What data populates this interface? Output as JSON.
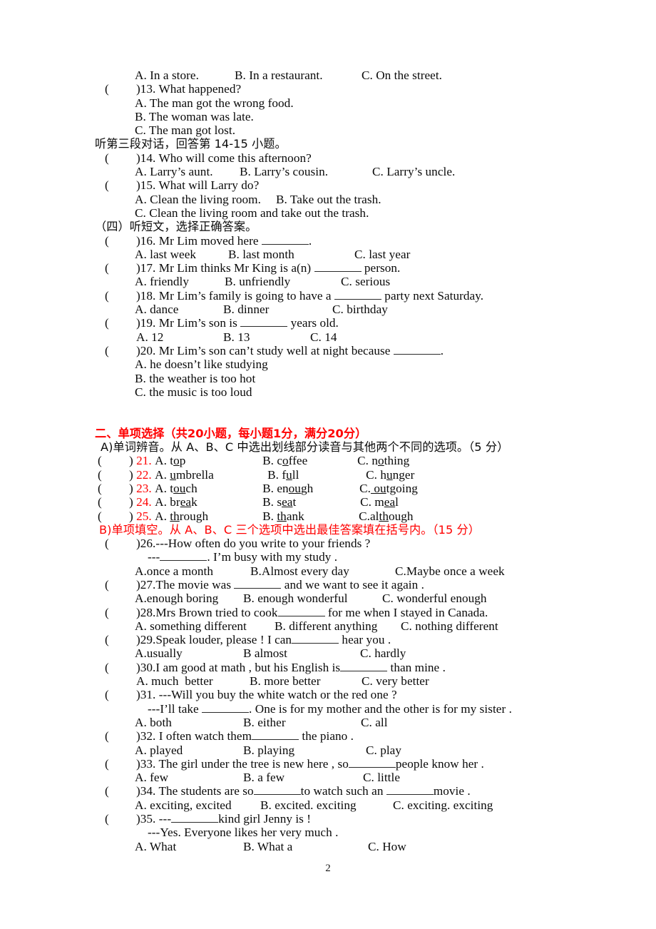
{
  "document": {
    "page_number": "2",
    "accent_color": "#ff0000",
    "text_color": "#0a0a0a"
  },
  "listening": {
    "q12_options": {
      "a": "A. In a store.",
      "b": "B. In a restaurant.",
      "c": "C. On the street."
    },
    "q13": {
      "number": ")13.",
      "stem": "What happened?",
      "a": "A. The man got the wrong food.",
      "b": "B. The woman was late.",
      "c": "C. The man got lost."
    },
    "dialogue3_heading": "听第三段对话，回答第 14-15 小题。",
    "q14": {
      "number": ")14.",
      "stem": "Who will come this afternoon?",
      "a": "A. Larry’s aunt.",
      "b": "B. Larry’s cousin.",
      "c": "C. Larry’s uncle."
    },
    "q15": {
      "number": ")15.",
      "stem": "What will Larry do?",
      "a": "A. Clean the living room.",
      "b": "B. Take out the trash.",
      "c": "C. Clean the living room and take out the trash."
    },
    "passage_heading": "（四）听短文，选择正确答案。",
    "q16": {
      "number": ")16.",
      "stem_before": "Mr Lim moved here ",
      "stem_after": ".",
      "a": "A. last week",
      "b": "B. last month",
      "c": "C. last year"
    },
    "q17": {
      "number": ")17.",
      "stem_before": "Mr Lim thinks Mr King is a(n) ",
      "stem_after": " person.",
      "a": "A. friendly",
      "b": "B. unfriendly",
      "c": "C. serious"
    },
    "q18": {
      "number": ")18.",
      "stem_before": "Mr Lim’s family is going to have a ",
      "stem_after": " party next Saturday.",
      "a": "A. dance",
      "b": "B. dinner",
      "c": "C. birthday"
    },
    "q19": {
      "number": ")19.",
      "stem_before": "Mr Lim’s son is ",
      "stem_after": " years old.",
      "a": "A. 12",
      "b": "B. 13",
      "c": "C. 14"
    },
    "q20": {
      "number": ")20.",
      "stem_before": "Mr Lim’s son can’t study well at night because ",
      "stem_after": ".",
      "a": "A. he doesn’t like studying",
      "b": "B. the weather is too hot",
      "c": "C. the music is too loud"
    }
  },
  "section2": {
    "heading": "二、单项选择（共20小题，每小题1分，满分20分）",
    "partA_heading": "A)单词辨音。从 A、B、C 中选出划线部分读音与其他两个不同的选项。（5 分）",
    "partB_heading": "B)单项填空。从 A、B、C 三个选项中选出最佳答案填在括号内。（15 分）",
    "phonetics": [
      {
        "number": "21.",
        "a_pre": "A. t",
        "a_u": "o",
        "a_post": "p",
        "b_pre": "B. c",
        "b_u": "o",
        "b_post": "ffee",
        "c_pre": "C. n",
        "c_u": "o",
        "c_post": "thing"
      },
      {
        "number": "22.",
        "a_pre": "A. ",
        "a_u": "u",
        "a_post": "mbrella",
        "b_pre": "B. f",
        "b_u": "u",
        "b_post": "ll",
        "c_pre": "C. h",
        "c_u": "u",
        "c_post": "nger"
      },
      {
        "number": "23.",
        "a_pre": "A. t",
        "a_u": "ou",
        "a_post": "ch",
        "b_pre": "B. en",
        "b_u": "ou",
        "b_post": "gh",
        "c_pre": "C.",
        "c_u": " ou",
        "c_post": "tgoing"
      },
      {
        "number": "24.",
        "a_pre": "A. br",
        "a_u": "ea",
        "a_post": "k",
        "b_pre": "B. s",
        "b_u": "ea",
        "b_post": "t",
        "c_pre": "C. m",
        "c_u": "ea",
        "c_post": "l"
      },
      {
        "number": "25.",
        "a_pre": "A. ",
        "a_u": "th",
        "a_post": "rough",
        "b_pre": "B. ",
        "b_u": "th",
        "b_post": "ank",
        "c_pre": "C.al",
        "c_u": "th",
        "c_post": "ough"
      }
    ],
    "q26": {
      "number": ")26.",
      "stem": "---How often do you write to your friends ?",
      "stem2_before": "---",
      "stem2_after": ". I’m busy with my study .",
      "a": "A.once a month",
      "b": "B.Almost every day",
      "c": "C.Maybe once a week"
    },
    "q27": {
      "number": ")27.",
      "stem_before": "The movie was ",
      "stem_after": " and we want to see it again .",
      "a": "A.enough boring",
      "b": "B. enough wonderful",
      "c": "C. wonderful enough"
    },
    "q28": {
      "number": ")28.",
      "stem_before": "Mrs Brown tried to cook",
      "stem_after": " for me when I stayed in Canada.",
      "a": "A. something different",
      "b": "B. different anything",
      "c": "C. nothing different"
    },
    "q29": {
      "number": ")29.",
      "stem_before": "Speak louder, please ! I can",
      "stem_after": " hear you .",
      "a": "A.usually",
      "b": "B almost",
      "c": "C. hardly"
    },
    "q30": {
      "number": ")30.",
      "stem_before": "I am good at math , but his English is",
      "stem_after": " than mine .",
      "a": "A. much  better",
      "b": "B. more better",
      "c": "C. very better"
    },
    "q31": {
      "number": ")31.",
      "stem": "---Will you buy the white watch or the red one ?",
      "stem2_before": "---I’ll take ",
      "stem2_after": ". One is for my mother and the other is for my sister .",
      "a": "A. both",
      "b": "B. either",
      "c": "C. all"
    },
    "q32": {
      "number": ")32.",
      "stem_before": "I often watch them",
      "stem_after": " the piano .",
      "a": "A. played",
      "b": "B. playing",
      "c": "C. play"
    },
    "q33": {
      "number": ")33.",
      "stem_before": "The girl under the tree is new here , so",
      "stem_after": "people know her .",
      "a": "A. few",
      "b": "B. a few",
      "c": "C. little"
    },
    "q34": {
      "number": ")34.",
      "stem_before": "The students are so",
      "stem_mid": "to watch such an ",
      "stem_after": "movie .",
      "a": "A. exciting, excited",
      "b": "B. excited. exciting",
      "c": "C. exciting. exciting"
    },
    "q35": {
      "number": ")35.",
      "stem_before": "---",
      "stem_after": "kind girl Jenny is !",
      "stem2": "---Yes. Everyone likes her very much .",
      "a": "A. What",
      "b": "B. What a",
      "c": "C. How"
    }
  }
}
